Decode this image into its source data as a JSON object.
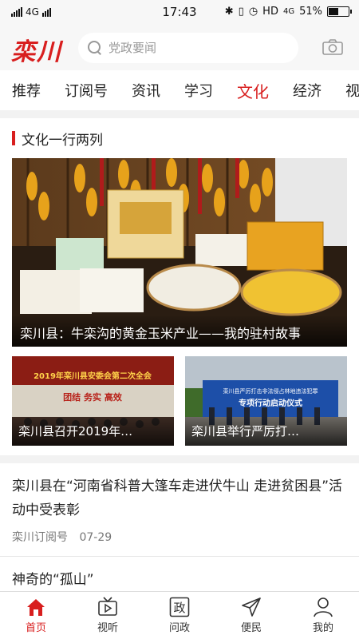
{
  "status_bar": {
    "network": "4G",
    "time": "17:43",
    "hd": "HD",
    "network2": "4G",
    "battery": "51%",
    "battery_level": 0.51
  },
  "header": {
    "logo": "栾川",
    "search_placeholder": "党政要闻"
  },
  "tabs": [
    {
      "label": "推荐"
    },
    {
      "label": "订阅号"
    },
    {
      "label": "资讯"
    },
    {
      "label": "学习"
    },
    {
      "label": "文化",
      "active": true
    },
    {
      "label": "经济"
    },
    {
      "label": "视频"
    }
  ],
  "section": {
    "title": "文化一行两列",
    "hero_caption": "栾川县：牛栾沟的黄金玉米产业——我的驻村故事",
    "thumbs": [
      {
        "caption": "栾川县召开2019年…",
        "banner": "2019年栾川县安委会第二次全会",
        "slogan": "团结 务实 高效"
      },
      {
        "caption": "栾川县举行严厉打…",
        "banner": "栾川县严厉打击非法侵占林地违法犯罪",
        "banner2": "专项行动启动仪式"
      }
    ]
  },
  "news": [
    {
      "title": "栾川县在“河南省科普大篷车走进伏牛山 走进贫困县”活动中受表彰",
      "source": "栾川订阅号",
      "date": "07-29"
    },
    {
      "title": "神奇的“孤山”"
    }
  ],
  "bottom_nav": [
    {
      "label": "首页",
      "icon": "home-icon",
      "active": true
    },
    {
      "label": "视听",
      "icon": "tv-icon"
    },
    {
      "label": "问政",
      "icon": "zheng-icon",
      "glyph": "政"
    },
    {
      "label": "便民",
      "icon": "send-icon"
    },
    {
      "label": "我的",
      "icon": "user-icon"
    }
  ],
  "colors": {
    "accent": "#d81e1e"
  }
}
